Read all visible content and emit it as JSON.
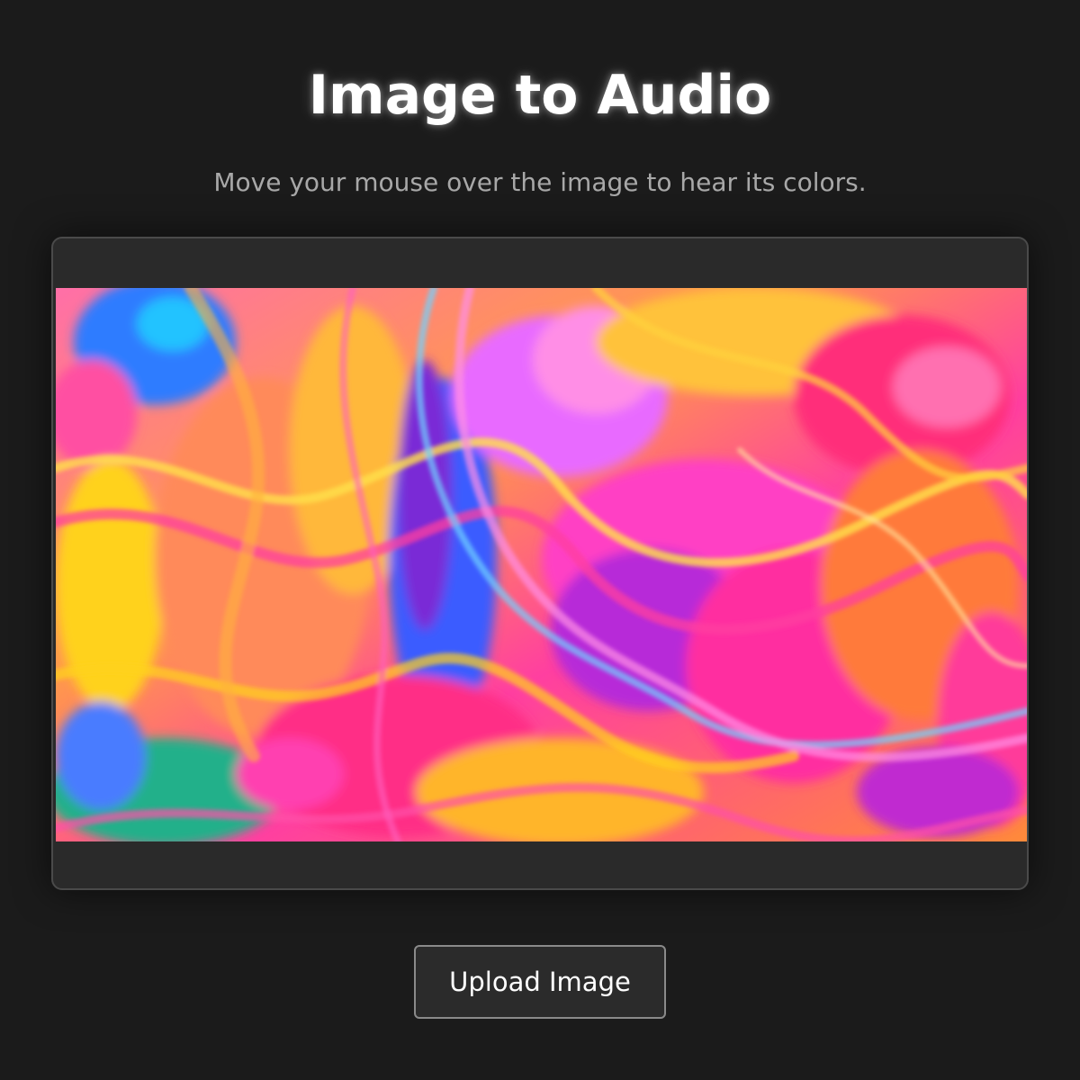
{
  "header": {
    "title": "Image to Audio",
    "subtitle": "Move your mouse over the image to hear its colors."
  },
  "viewer": {
    "image_icon": "abstract-swirl-image"
  },
  "actions": {
    "upload_label": "Upload Image"
  },
  "colors": {
    "background": "#1b1b1b",
    "panel": "#2a2a2a",
    "panel_border": "#4a4a4a",
    "subtitle": "#a8a8a8",
    "button_border": "#8a8a8a"
  }
}
